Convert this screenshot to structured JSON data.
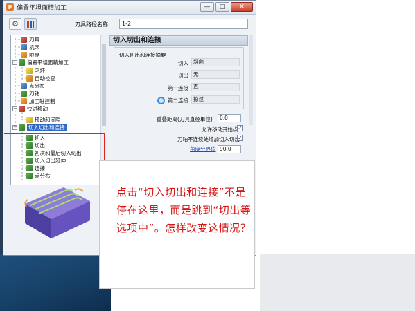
{
  "window": {
    "title": "偏置平坦面精加工",
    "app_icon": "P",
    "minimize": "—",
    "maximize": "□",
    "close": "✕"
  },
  "toolbar": {
    "path_name_label": "刀具路径名称",
    "path_name_value": "1-2"
  },
  "tree": {
    "items": [
      {
        "label": "刀具",
        "icon": "tool-icon"
      },
      {
        "label": "机床",
        "icon": "machine-icon"
      },
      {
        "label": "限界",
        "icon": "limit-icon"
      },
      {
        "label": "偏置平坦面精加工",
        "icon": "strategy-icon"
      },
      {
        "label": "毛坯",
        "icon": "stock-icon"
      },
      {
        "label": "自动检查",
        "icon": "check-icon"
      },
      {
        "label": "点分布",
        "icon": "point-icon"
      },
      {
        "label": "刀轴",
        "icon": "axis-icon"
      },
      {
        "label": "加工轴控制",
        "icon": "axis-control-icon"
      },
      {
        "label": "快进移动",
        "icon": "rapid-icon"
      },
      {
        "label": "移动和间隙",
        "icon": "move-icon"
      },
      {
        "label": "切入切出和连接",
        "icon": "lead-icon"
      },
      {
        "label": "切入",
        "icon": "lead-in-icon"
      },
      {
        "label": "切出",
        "icon": "lead-out-icon"
      },
      {
        "label": "初次和最后切入切出",
        "icon": "first-last-icon"
      },
      {
        "label": "切入切出延伸",
        "icon": "extension-icon"
      },
      {
        "label": "连接",
        "icon": "link-icon"
      },
      {
        "label": "点分布",
        "icon": "point-icon"
      }
    ]
  },
  "panel": {
    "header": "切入切出和连接",
    "summary_title": "切入切出和连接摘要",
    "summary": [
      {
        "label": "切入",
        "value": "斜向"
      },
      {
        "label": "切出",
        "value": "无"
      },
      {
        "label": "第一连接",
        "value": "直"
      },
      {
        "label": "第二连接",
        "value": "掠过"
      }
    ],
    "overlap_label": "重叠距离(刀具直径单位)",
    "overlap_value": "0.0",
    "start_point_label": "允许移动开始点",
    "start_point_checked": "✓",
    "axis_add_label": "刀轴不连续处增加切入切出",
    "axis_add_checked": "✓",
    "angle_label": "角度分界值",
    "angle_value": "90.0"
  },
  "annotation": {
    "text": "点击“切入切出和连接”不是停在这里，而是跳到“切出等选项中”。怎样改变这情况？",
    "color": "#d71515"
  }
}
